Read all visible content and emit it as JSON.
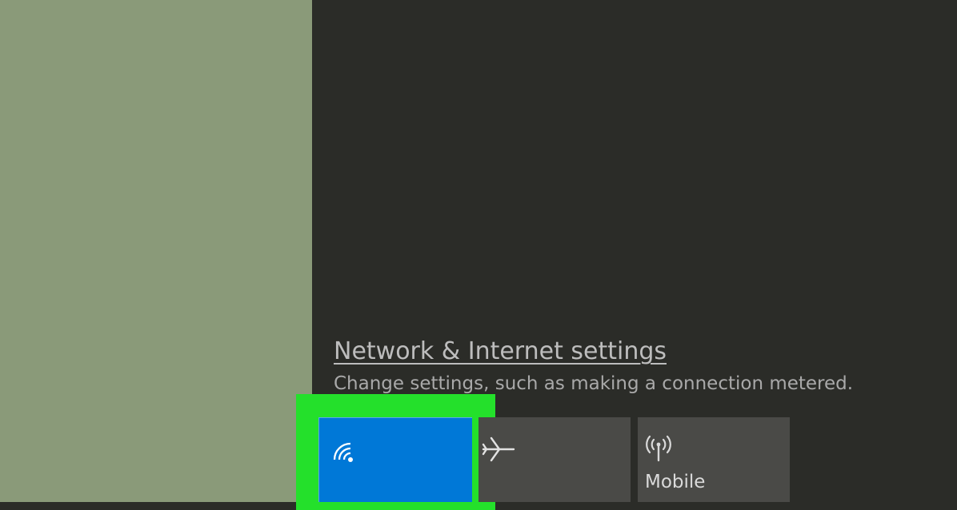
{
  "network_settings": {
    "link_label": "Network & Internet settings",
    "description": "Change settings, such as making a connection metered."
  },
  "quick_actions": {
    "wifi": {
      "icon": "wifi-icon",
      "label": ""
    },
    "airplane": {
      "icon": "airplane-icon",
      "label": ""
    },
    "mobile": {
      "icon": "mobile-hotspot-icon",
      "label": "Mobile"
    }
  },
  "colors": {
    "highlight_box": "#24e02b",
    "wifi_tile_active": "#0078d7",
    "tile_inactive": "#4a4a47",
    "flyout_background": "#2b2c28",
    "desktop_background": "#8a9a79"
  }
}
